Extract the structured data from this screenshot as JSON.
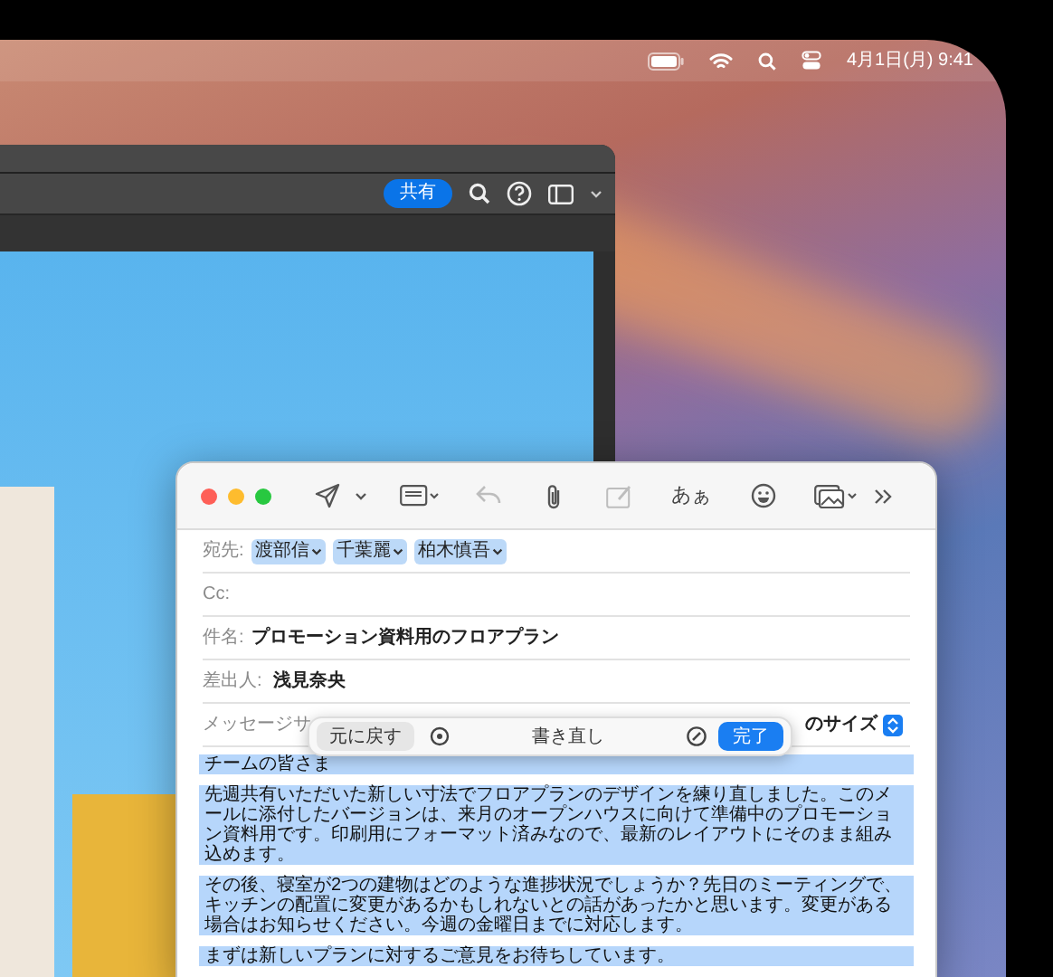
{
  "menu_bar": {
    "date_time": "4月1日(月) 9:41"
  },
  "background_window": {
    "share_button": "共有"
  },
  "mail_window": {
    "toolbar": [
      {
        "kind": "send",
        "disabled": false
      },
      {
        "kind": "send-menu",
        "disabled": false
      },
      {
        "kind": "header",
        "disabled": false
      },
      {
        "kind": "reply",
        "disabled": true
      },
      {
        "kind": "attach",
        "disabled": false
      },
      {
        "kind": "markup",
        "disabled": true
      },
      {
        "kind": "format",
        "label": "あぁ",
        "disabled": false
      },
      {
        "kind": "emoji",
        "disabled": false
      },
      {
        "kind": "photo",
        "disabled": false
      },
      {
        "kind": "more",
        "disabled": false
      }
    ],
    "to_label": "宛先:",
    "recipients": [
      "渡部信",
      "千葉麗",
      "柏木慎吾"
    ],
    "cc_label": "Cc:",
    "subject_label": "件名:",
    "subject": "プロモーション資料用のフロアプラン",
    "from_label": "差出人:",
    "from": "浅見奈央",
    "size_label": "メッセージサ",
    "size_value": "のサイズ",
    "body": {
      "selected": true,
      "paragraphs": [
        "チームの皆さま",
        "先週共有いただいた新しい寸法でフロアプランのデザインを練り直しました。このメールに添付したバージョンは、来月のオープンハウスに向けて準備中のプロモーション資料用です。印刷用にフォーマット済みなので、最新のレイアウトにそのまま組み込めます。",
        "その後、寝室が2つの建物はどのような進捗状況でしょうか？先日のミーティングで、キッチンの配置に変更があるかもしれないとの話があったかと思います。変更がある場合はお知らせください。今週の金曜日までに対応します。",
        "まずは新しいプランに対するご意見をお待ちしています。"
      ]
    }
  },
  "writing_tools": {
    "undo_button": "元に戻す",
    "title": "書き直し",
    "done_button": "完了"
  }
}
